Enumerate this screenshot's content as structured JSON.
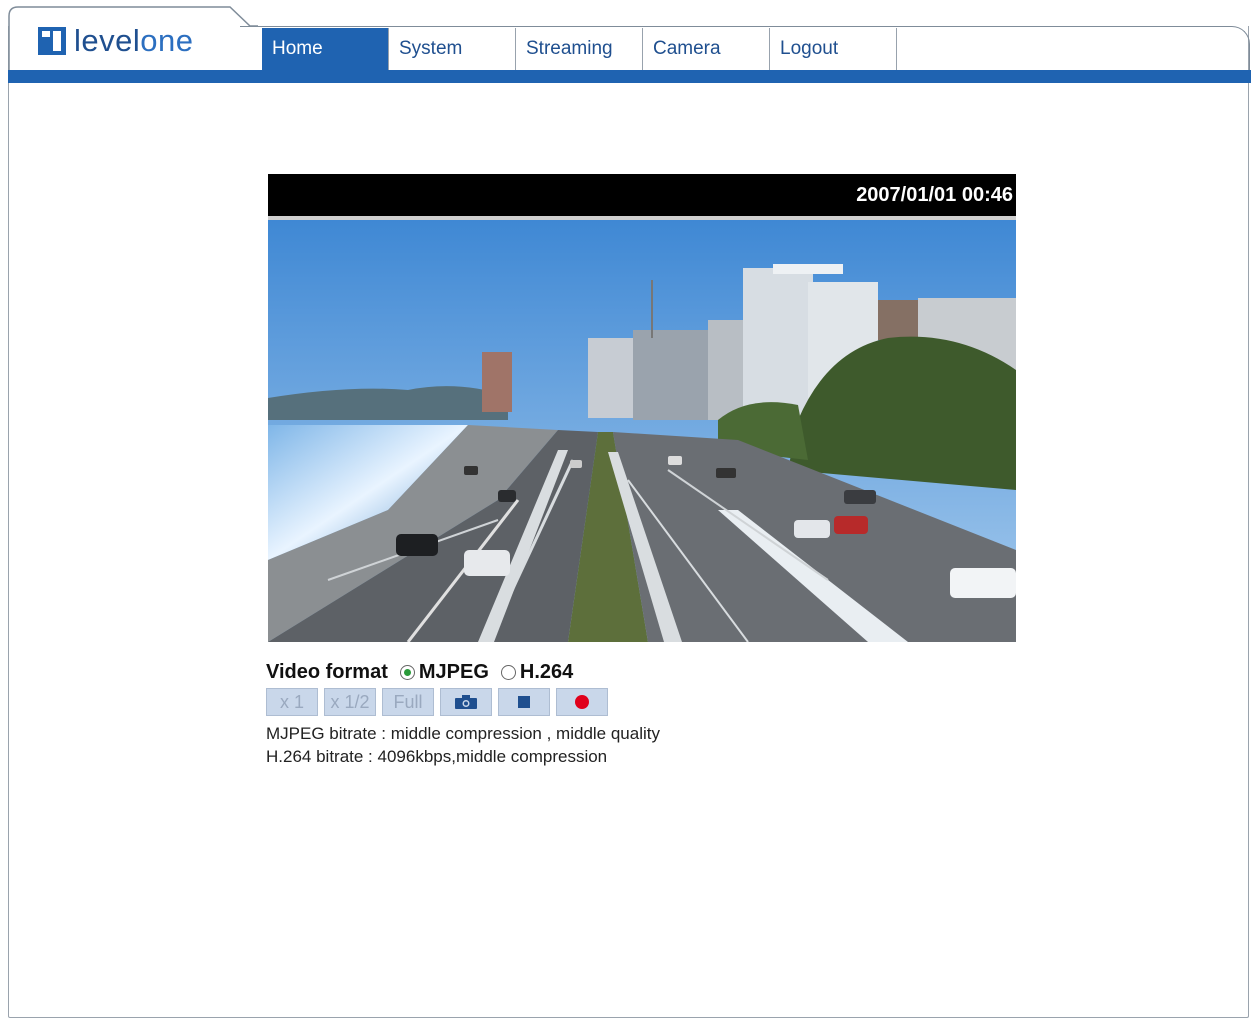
{
  "brand": {
    "logo_text_a": "level",
    "logo_text_b": "one"
  },
  "nav": {
    "items": [
      {
        "label": "Home",
        "active": true
      },
      {
        "label": "System",
        "active": false
      },
      {
        "label": "Streaming",
        "active": false
      },
      {
        "label": "Camera",
        "active": false
      },
      {
        "label": "Logout",
        "active": false
      }
    ]
  },
  "viewer": {
    "timestamp": "2007/01/01 00:46"
  },
  "controls": {
    "format_label": "Video format",
    "formats": [
      {
        "label": "MJPEG",
        "selected": true
      },
      {
        "label": "H.264",
        "selected": false
      }
    ],
    "buttons": {
      "x1": "x 1",
      "half": "x 1/2",
      "full": "Full",
      "snapshot_icon": "camera-icon",
      "stop_icon": "stop-icon",
      "record_icon": "record-icon"
    },
    "bitrate_mjpeg": "MJPEG bitrate : middle compression , middle quality",
    "bitrate_h264": "H.264 bitrate : 4096kbps,middle compression"
  },
  "colors": {
    "accent": "#1f63b1",
    "record": "#e0001b"
  }
}
